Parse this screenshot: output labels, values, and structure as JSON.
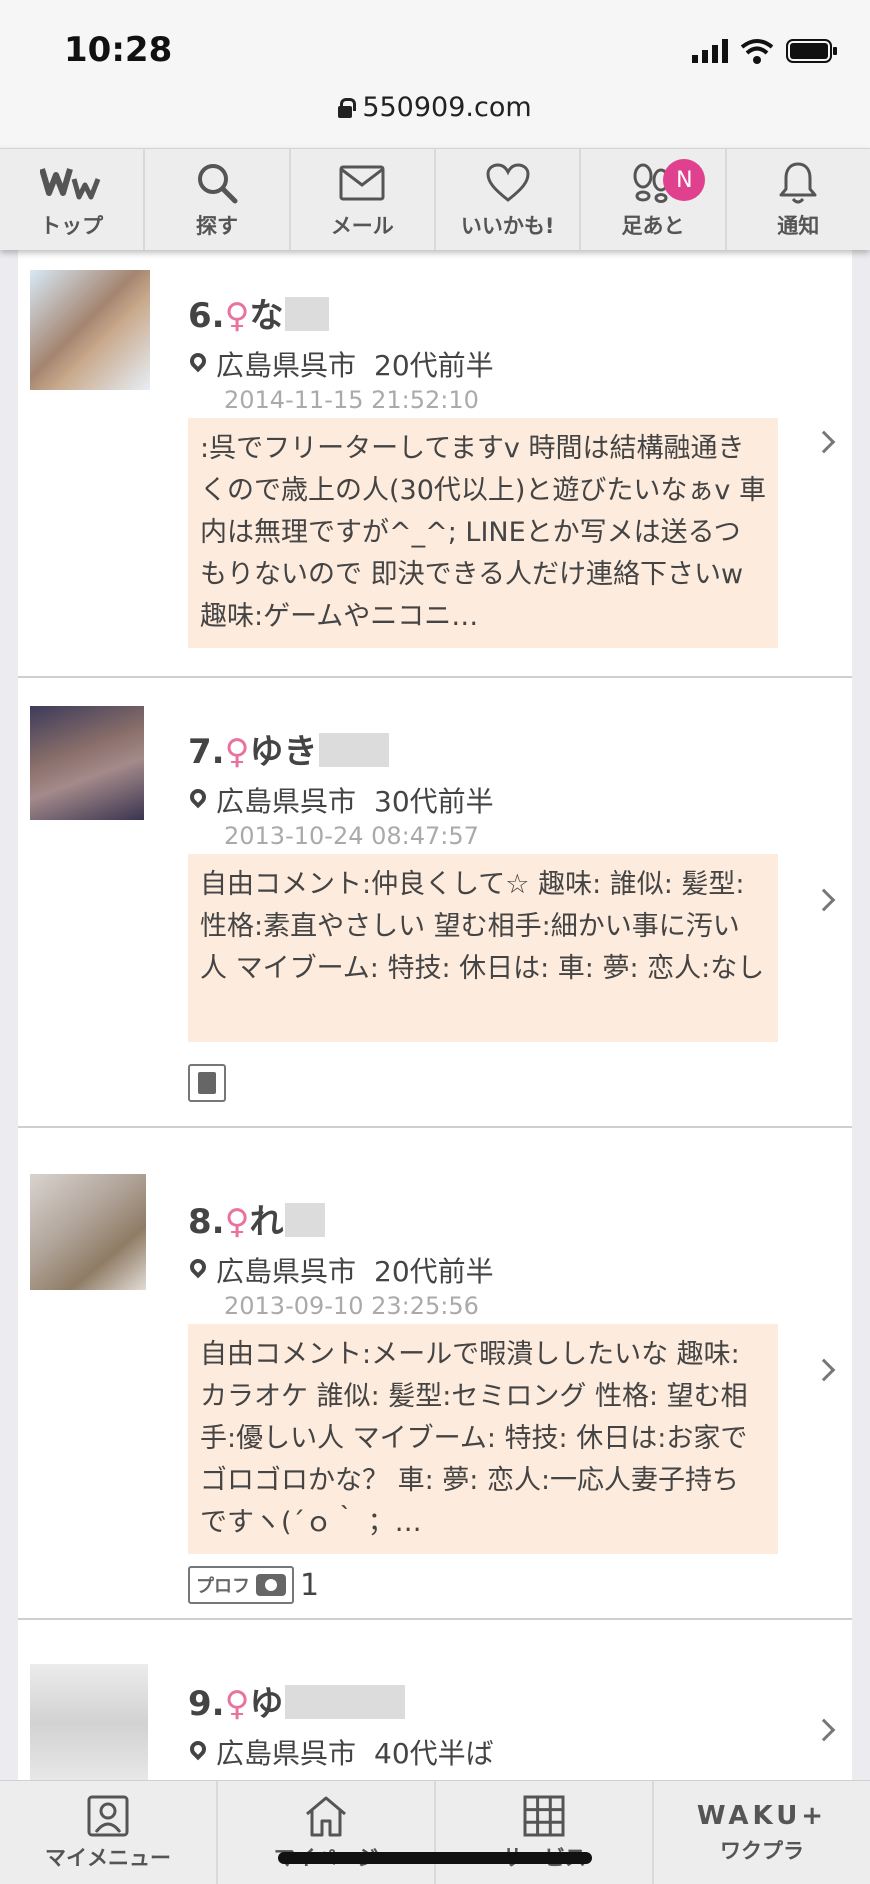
{
  "status": {
    "time": "10:28",
    "url": "550909.com"
  },
  "topnav": [
    {
      "label": "トップ",
      "icon": "ww-logo-icon"
    },
    {
      "label": "探す",
      "icon": "search-icon"
    },
    {
      "label": "メール",
      "icon": "mail-icon"
    },
    {
      "label": "いいかも!",
      "icon": "heart-icon"
    },
    {
      "label": "足あと",
      "icon": "footprint-icon",
      "badge": "N"
    },
    {
      "label": "通知",
      "icon": "bell-icon"
    }
  ],
  "profiles": [
    {
      "number": "6.",
      "gender": "♀",
      "name": "な",
      "location": "広島県呉市",
      "age": "20代前半",
      "date": "2014-11-15 21:52:10",
      "comment": ":呉でフリーターしてますv 時間は結構融通きくので歳上の人(30代以上)と遊びたいなぁv 車内は無理ですが^_^; LINEとか写メは送るつもりないので 即決できる人だけ連絡下さいw 趣味:ゲームやニコニ…"
    },
    {
      "number": "7.",
      "gender": "♀",
      "name": "ゆき",
      "location": "広島県呉市",
      "age": "30代前半",
      "date": "2013-10-24 08:47:57",
      "comment": "自由コメント:仲良くして☆ 趣味: 誰似: 髪型: 性格:素直やさしい 望む相手:細かい事に汚い人 マイブーム: 特技: 休日は: 車: 夢: 恋人:なし"
    },
    {
      "number": "8.",
      "gender": "♀",
      "name": "れ",
      "location": "広島県呉市",
      "age": "20代前半",
      "date": "2013-09-10 23:25:56",
      "comment": "自由コメント:メールで暇潰ししたいな 趣味:カラオケ 誰似: 髪型:セミロング 性格: 望む相手:優しい人 マイブーム: 特技: 休日は:お家でゴロゴロかな？ 車: 夢: 恋人:一応人妻子持ちですヽ(´ｏ｀ ；…",
      "prof_label": "プロフ",
      "prof_count": "1"
    },
    {
      "number": "9.",
      "gender": "♀",
      "name": "ゆ",
      "location": "広島県呉市",
      "age": "40代半ば"
    }
  ],
  "bottomnav": [
    {
      "label": "マイメニュー",
      "icon": "profile-card-icon"
    },
    {
      "label": "マイページ",
      "icon": "home-icon"
    },
    {
      "label": "サービス",
      "icon": "grid-icon"
    },
    {
      "label": "ワクプラ",
      "icon": "waku-plus-logo",
      "logo_text": "WAKU+"
    }
  ]
}
